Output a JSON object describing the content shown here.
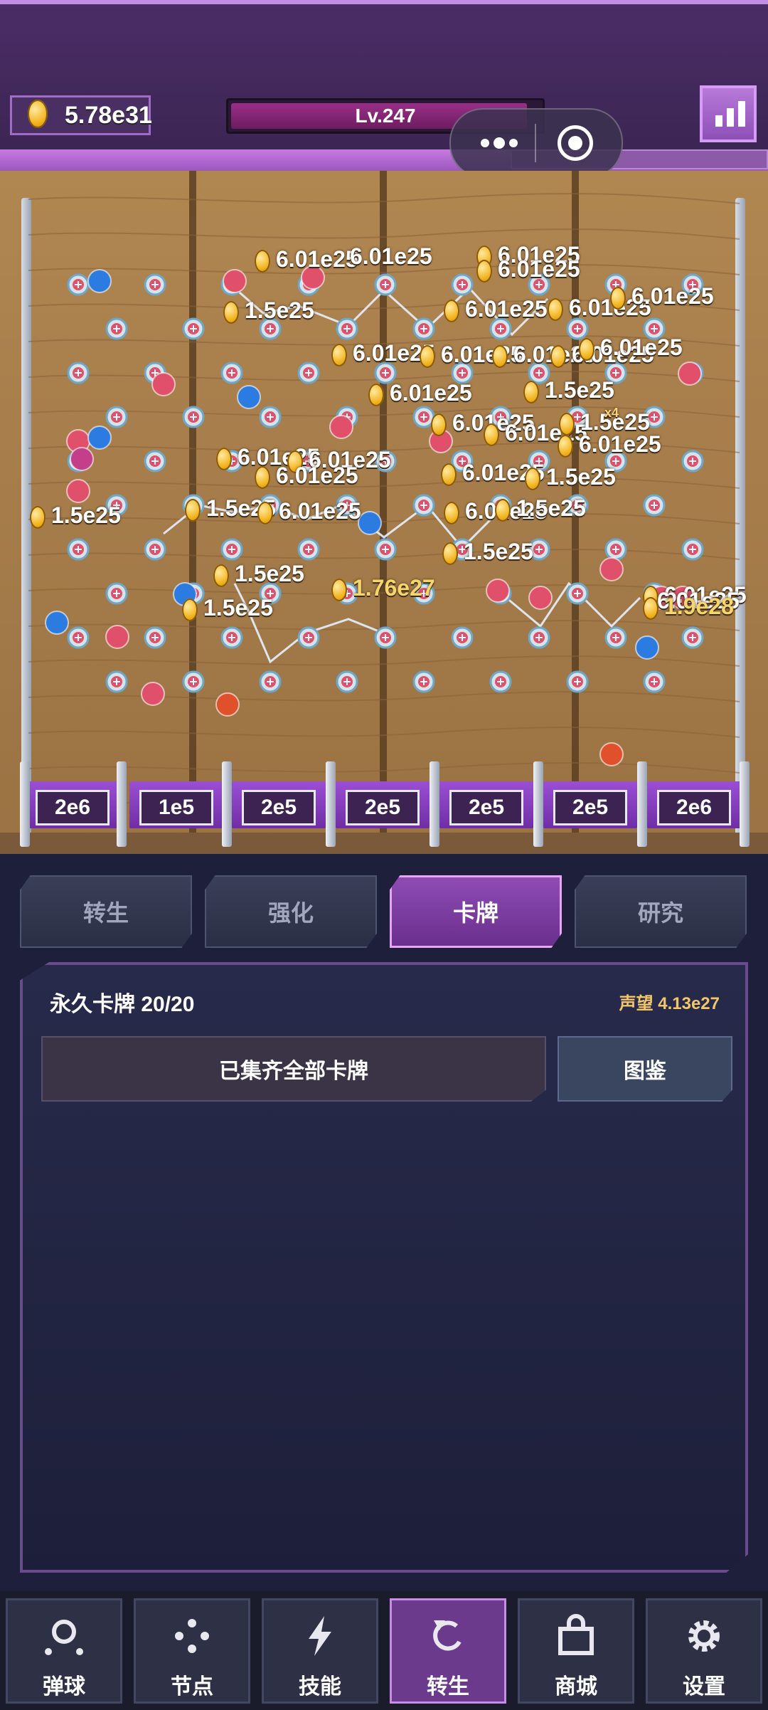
{
  "header": {
    "coins": "5.78e31",
    "level": "Lv.247",
    "level_progress": 0.96,
    "more_icon": "more-dots-icon",
    "target_icon": "target-icon",
    "stats_icon": "bar-chart-icon"
  },
  "board": {
    "popups": [
      {
        "text": "6.01e25",
        "coin": true
      },
      {
        "text": "6.01e25",
        "coin": false
      },
      {
        "text": "6.01e25",
        "coin": true
      },
      {
        "text": "6.01e25",
        "coin": true
      },
      {
        "text": "1.5e25",
        "coin": true
      },
      {
        "text": "6.01e25",
        "coin": true
      },
      {
        "text": "6.01e25",
        "coin": true
      },
      {
        "text": "6.01e25",
        "coin": true
      },
      {
        "text": "6.01e25",
        "coin": true
      },
      {
        "text": "6.01e25",
        "coin": true
      },
      {
        "text": "6.01e25",
        "coin": true
      },
      {
        "text": "6.01e25",
        "coin": true
      },
      {
        "text": "6.01e25",
        "coin": true
      },
      {
        "text": "6.01e25",
        "coin": true
      },
      {
        "text": "1.5e25",
        "coin": true
      },
      {
        "text": "6.01e25",
        "coin": true
      },
      {
        "text": "6.01e25",
        "coin": true
      },
      {
        "text": "1.5e25",
        "coin": true
      },
      {
        "text": "6.01e25",
        "coin": true
      },
      {
        "text": "6.01e25",
        "coin": true
      },
      {
        "text": "6.01e25",
        "coin": true
      },
      {
        "text": "6.01e25",
        "coin": true
      },
      {
        "text": "6.01e25",
        "coin": true
      },
      {
        "text": "1.5e25",
        "coin": true
      },
      {
        "text": "1.5e25",
        "coin": true
      },
      {
        "text": "6.01e25",
        "coin": true
      },
      {
        "text": "6.01e25",
        "coin": true
      },
      {
        "text": "1.5e25",
        "coin": true
      },
      {
        "text": "1.5e25",
        "coin": true
      },
      {
        "text": "1.5e25",
        "coin": true
      },
      {
        "text": "1.5e25",
        "coin": true
      },
      {
        "text": "1.5e25",
        "coin": true
      },
      {
        "text": "6.01e25",
        "coin": true
      },
      {
        "text": "6.01e25",
        "coin": false
      }
    ],
    "slots": [
      "2e6",
      "1e5",
      "2e5",
      "2e5",
      "2e5",
      "2e5",
      "2e6"
    ],
    "slot_rewards": [
      {
        "text": "1.76e27",
        "coin": true
      },
      {
        "text": "1.9e28",
        "coin": true
      }
    ],
    "multiplier_badge": "x4"
  },
  "tabs": [
    {
      "label": "转生",
      "active": false
    },
    {
      "label": "强化",
      "active": false
    },
    {
      "label": "卡牌",
      "active": true
    },
    {
      "label": "研究",
      "active": false
    }
  ],
  "panel": {
    "title": "永久卡牌 20/20",
    "prestige": "声望 4.13e27",
    "status": "已集齐全部卡牌",
    "codex": "图鉴"
  },
  "nav": [
    {
      "label": "弹球",
      "icon": "pinball-icon",
      "active": false
    },
    {
      "label": "节点",
      "icon": "nodes-icon",
      "active": false
    },
    {
      "label": "技能",
      "icon": "lightning-icon",
      "active": false
    },
    {
      "label": "转生",
      "icon": "refresh-icon",
      "active": true
    },
    {
      "label": "商城",
      "icon": "shop-bag-icon",
      "active": false
    },
    {
      "label": "设置",
      "icon": "gear-icon",
      "active": false
    }
  ]
}
